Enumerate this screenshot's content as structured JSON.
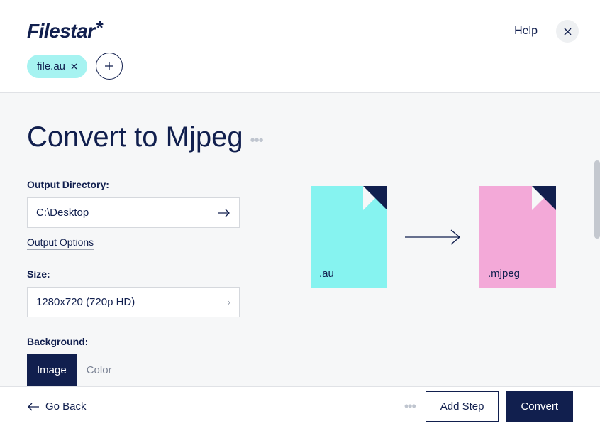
{
  "header": {
    "logo": "Filestar",
    "help": "Help"
  },
  "files": {
    "name": "file.au",
    "add": "+"
  },
  "page": {
    "title": "Convert to Mjpeg"
  },
  "form": {
    "outdir_label": "Output Directory:",
    "outdir_value": "C:\\Desktop",
    "output_options": "Output Options",
    "size_label": "Size:",
    "size_value": "1280x720 (720p HD)",
    "bg_label": "Background:",
    "bg_image": "Image",
    "bg_color": "Color"
  },
  "diagram": {
    "src_ext": ".au",
    "dst_ext": ".mjpeg"
  },
  "footer": {
    "back": "Go Back",
    "add_step": "Add Step",
    "convert": "Convert"
  }
}
